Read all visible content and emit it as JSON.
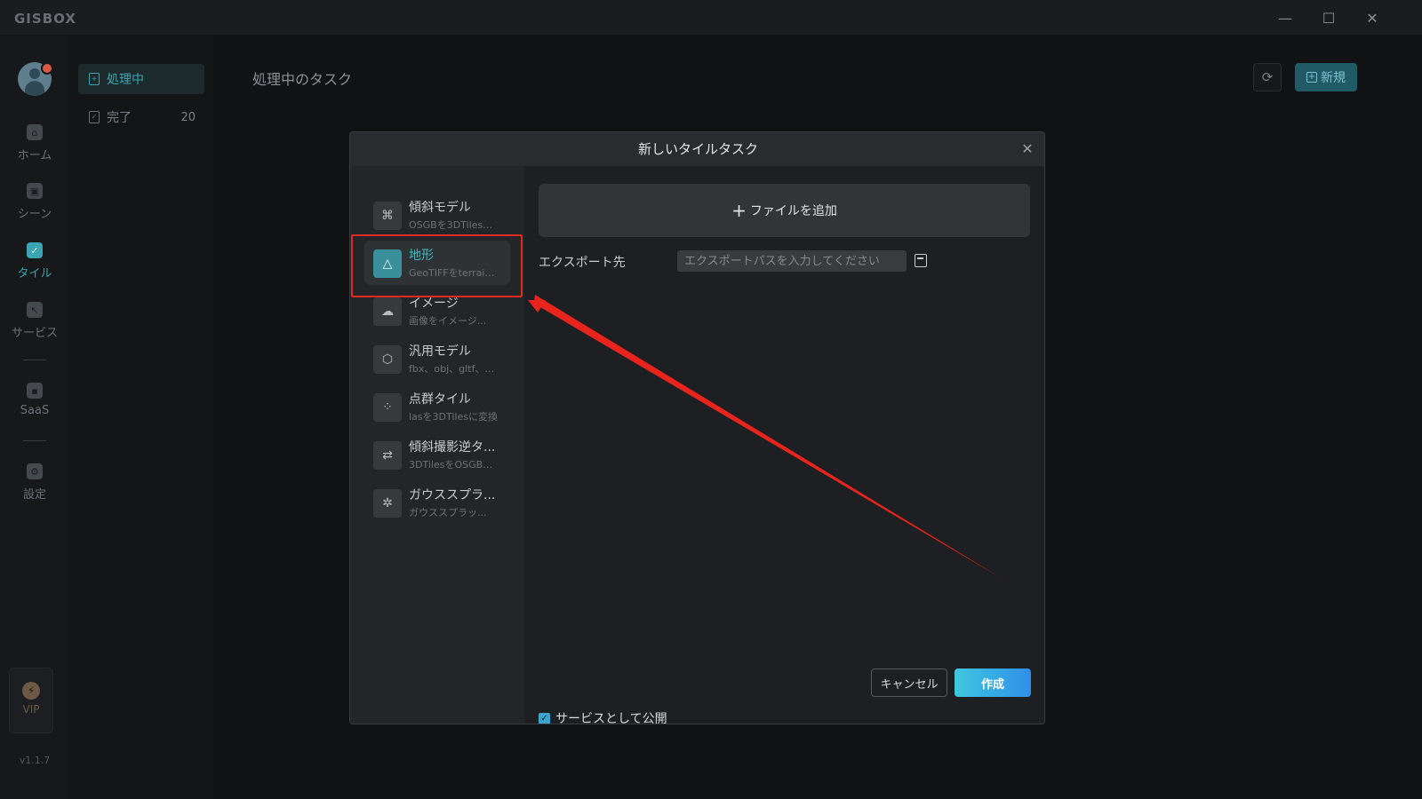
{
  "app": {
    "logo": "GISBOX",
    "window_controls": [
      "—",
      "☐",
      "✕"
    ],
    "version": "v1.1.7"
  },
  "rail": {
    "items": [
      {
        "label": "ホーム",
        "icon": "home-icon",
        "active": false
      },
      {
        "label": "シーン",
        "icon": "scene-icon",
        "active": false
      },
      {
        "label": "タイル",
        "icon": "tile-icon",
        "active": true
      },
      {
        "label": "サービス",
        "icon": "service-icon",
        "active": false
      },
      {
        "label": "SaaS",
        "icon": "lock-icon",
        "active": false
      },
      {
        "label": "設定",
        "icon": "gear-icon",
        "active": false
      }
    ],
    "vip_label": "VIP"
  },
  "subnav": {
    "items": [
      {
        "label": "処理中",
        "count": "",
        "active": true
      },
      {
        "label": "完了",
        "count": "20",
        "active": false
      }
    ]
  },
  "main": {
    "title": "処理中のタスク",
    "refresh_icon": "⟳",
    "new_label": "新規"
  },
  "modal": {
    "title": "新しいタイルタスク",
    "close_icon": "✕",
    "task_types": [
      {
        "name": "傾斜モデル",
        "desc": "OSGBを3DTilesに...",
        "icon": "command-icon",
        "glyph": "⌘",
        "active": false
      },
      {
        "name": "地形",
        "desc": "GeoTIFFをterrain...",
        "icon": "terrain-icon",
        "glyph": "△",
        "active": true
      },
      {
        "name": "イメージ",
        "desc": "画像をイメージ...",
        "icon": "cloud-icon",
        "glyph": "☁",
        "active": false
      },
      {
        "name": "汎用モデル",
        "desc": "fbx、obj、gltf、g...",
        "icon": "cube-icon",
        "glyph": "⬡",
        "active": false
      },
      {
        "name": "点群タイル",
        "desc": "lasを3DTilesに変換",
        "icon": "point-cloud-icon",
        "glyph": "⁘",
        "active": false
      },
      {
        "name": "傾斜撮影逆タ...",
        "desc": "3DTilesをOSGBに...",
        "icon": "reverse-icon",
        "glyph": "⇄",
        "active": false
      },
      {
        "name": "ガウススプラ...",
        "desc": "ガウススプラッ...",
        "icon": "gaussian-icon",
        "glyph": "✲",
        "active": false
      }
    ],
    "add_file_label": "ファイルを追加",
    "add_file_plus": "+",
    "export_label": "エクスポート先",
    "export_placeholder": "エクスポートパスを入力してください",
    "export_value": "",
    "publish_label": "サービスとして公開",
    "publish_checked": true,
    "cancel_label": "キャンセル",
    "create_label": "作成"
  },
  "annotation": {
    "highlight_color": "#e02a22",
    "arrow_color": "#e8241c"
  }
}
